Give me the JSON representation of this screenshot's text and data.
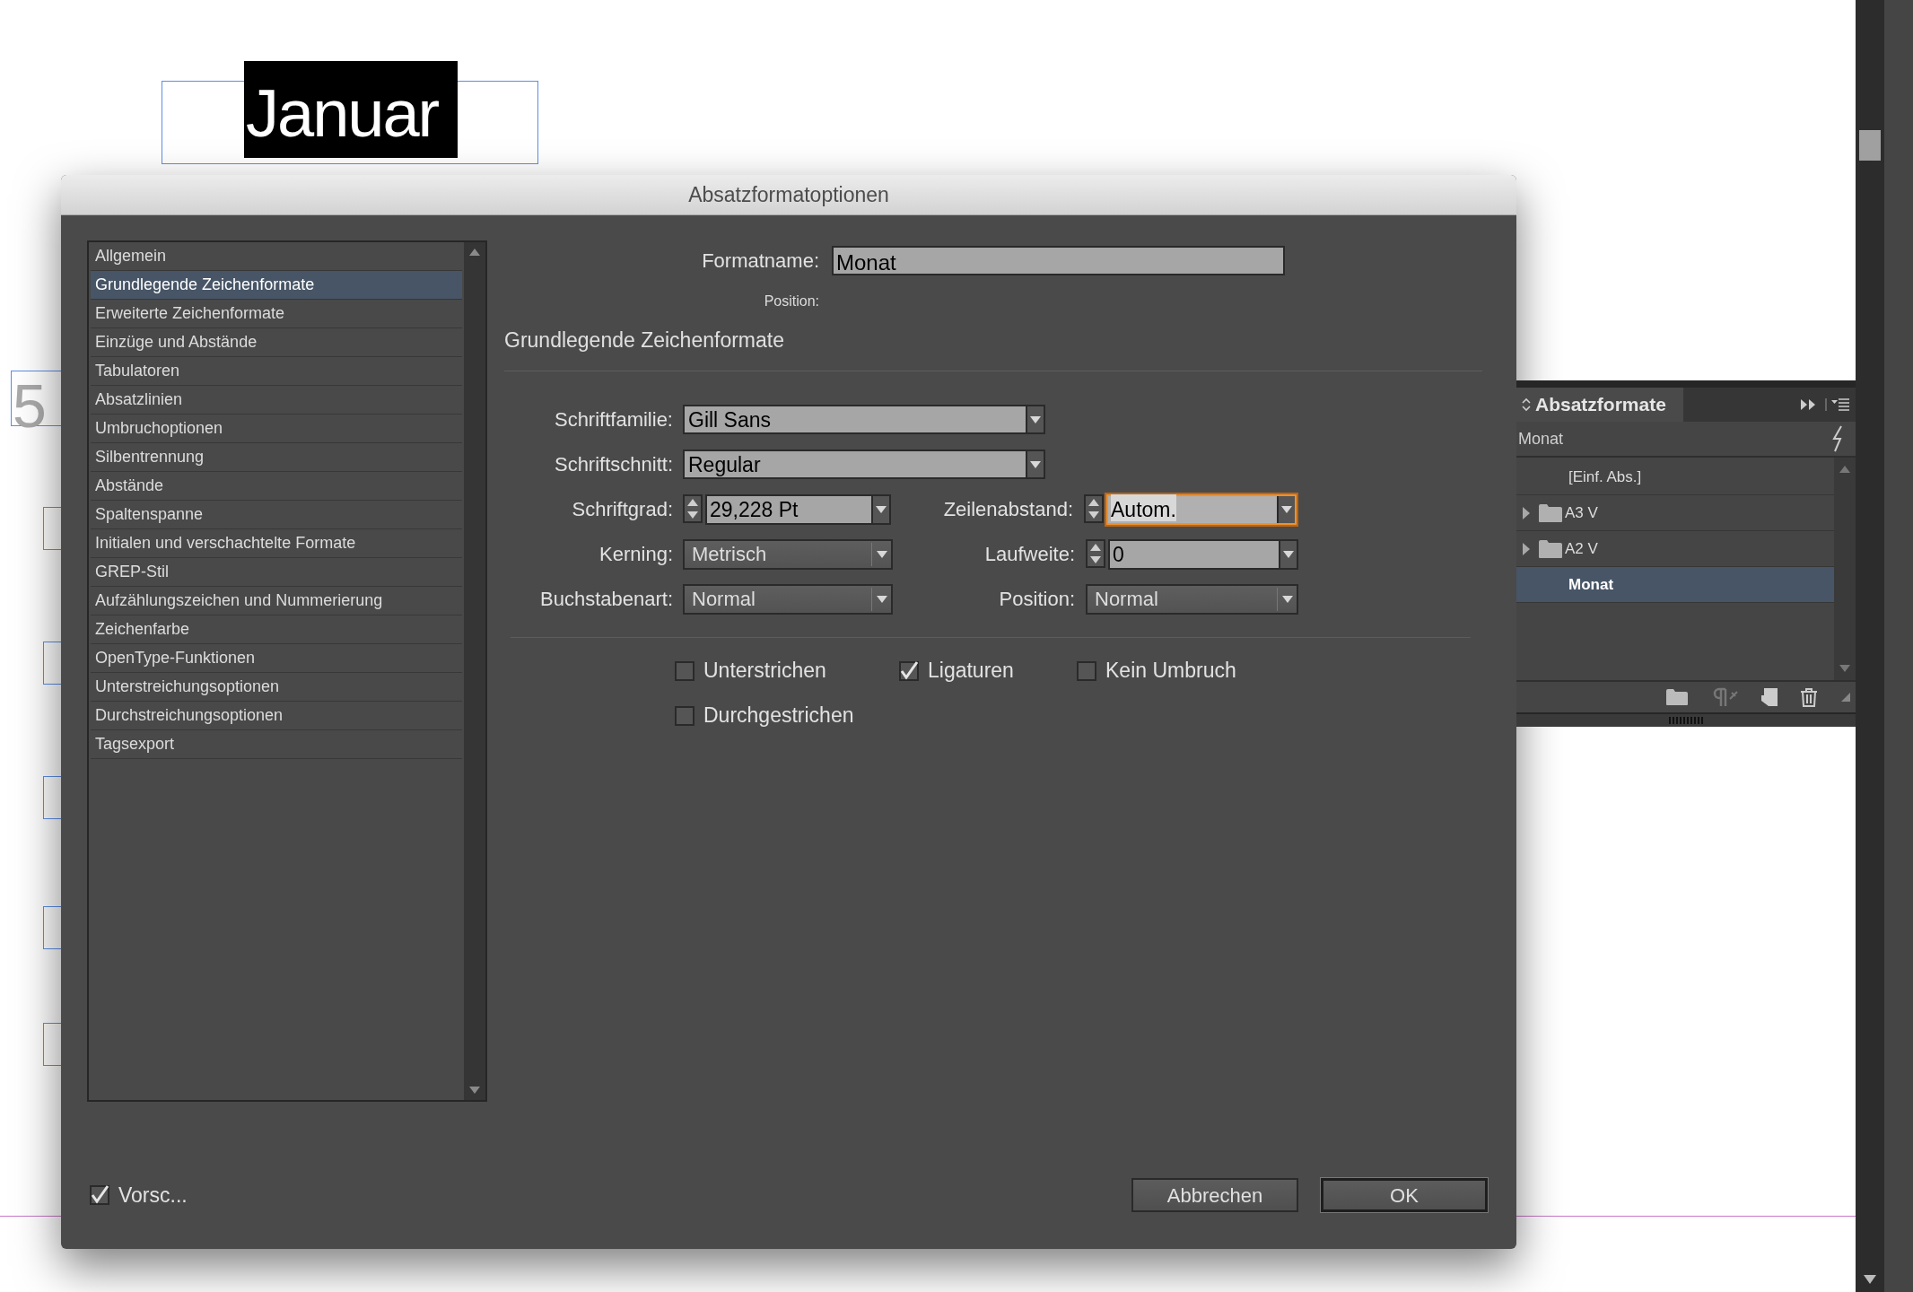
{
  "document": {
    "heading": "Januar",
    "number_fragment": "5"
  },
  "dialog": {
    "title": "Absatzformatoptionen",
    "categories": [
      {
        "label": "Allgemein",
        "selected": false
      },
      {
        "label": "Grundlegende Zeichenformate",
        "selected": true
      },
      {
        "label": "Erweiterte Zeichenformate",
        "selected": false
      },
      {
        "label": "Einzüge und Abstände",
        "selected": false
      },
      {
        "label": "Tabulatoren",
        "selected": false
      },
      {
        "label": "Absatzlinien",
        "selected": false
      },
      {
        "label": "Umbruchoptionen",
        "selected": false
      },
      {
        "label": "Silbentrennung",
        "selected": false
      },
      {
        "label": "Abstände",
        "selected": false
      },
      {
        "label": "Spaltenspanne",
        "selected": false
      },
      {
        "label": "Initialen und verschachtelte Formate",
        "selected": false
      },
      {
        "label": "GREP-Stil",
        "selected": false
      },
      {
        "label": "Aufzählungszeichen und Nummerierung",
        "selected": false
      },
      {
        "label": "Zeichenfarbe",
        "selected": false
      },
      {
        "label": "OpenType-Funktionen",
        "selected": false
      },
      {
        "label": "Unterstreichungsoptionen",
        "selected": false
      },
      {
        "label": "Durchstreichungsoptionen",
        "selected": false
      },
      {
        "label": "Tagsexport",
        "selected": false
      }
    ],
    "format_name": {
      "label": "Formatname:",
      "value": "Monat"
    },
    "position_label": "Position:",
    "section_title": "Grundlegende Zeichenformate",
    "rows": [
      {
        "left": {
          "label": "Schriftfamilie:",
          "value": "Gill Sans",
          "kind": "combo",
          "focused": false
        }
      },
      {
        "left": {
          "label": "Schriftschnitt:",
          "value": "Regular",
          "kind": "combo",
          "focused": false
        }
      },
      {
        "left": {
          "label": "Schriftgrad:",
          "value": "29,228 Pt",
          "kind": "spinner",
          "focused": false
        },
        "right": {
          "label": "Zeilenabstand:",
          "value": "Autom.",
          "kind": "spinner",
          "focused": true
        }
      },
      {
        "left": {
          "label": "Kerning:",
          "value": "Metrisch",
          "kind": "popup",
          "focused": false
        },
        "right": {
          "label": "Laufweite:",
          "value": "0",
          "kind": "spinner",
          "focused": false
        }
      },
      {
        "left": {
          "label": "Buchstabenart:",
          "value": "Normal",
          "kind": "popup",
          "focused": false
        },
        "right": {
          "label": "Position:",
          "value": "Normal",
          "kind": "popup",
          "focused": false
        }
      }
    ],
    "checkboxes": [
      {
        "label": "Unterstrichen",
        "checked": false
      },
      {
        "label": "Ligaturen",
        "checked": true
      },
      {
        "label": "Kein Umbruch",
        "checked": false
      },
      {
        "label": "Durchgestrichen",
        "checked": false
      }
    ],
    "preview": {
      "label": "Vorsc...",
      "checked": true
    },
    "buttons": [
      {
        "label": "Abbrechen",
        "default": false
      },
      {
        "label": "OK",
        "default": true
      }
    ]
  },
  "styles_panel": {
    "title": "Absatzformate",
    "current": "Monat",
    "items": [
      {
        "label": "[Einf. Abs.]",
        "kind": "style",
        "selected": false
      },
      {
        "label": "A3 V",
        "kind": "group",
        "selected": false
      },
      {
        "label": "A2 V",
        "kind": "group",
        "selected": false
      },
      {
        "label": "Monat",
        "kind": "style",
        "selected": true
      }
    ]
  }
}
